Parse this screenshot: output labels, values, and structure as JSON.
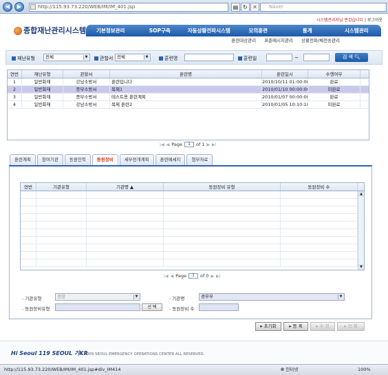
{
  "browser": {
    "address": "http://115.93.73.220/WEB/IM/IM_401.jsp",
    "search_placeholder": "Naver"
  },
  "header": {
    "welcome": "시스템관리자님 반갑습니다",
    "logout": "로그아웃",
    "logo_text": "종합재난관리시스템",
    "menu": [
      "기본정보관리",
      "SOP구축",
      "자동상황전파시스템",
      "모의훈련",
      "통계",
      "시스템관리"
    ],
    "submenu": [
      "훈련대상관리",
      "표준메시지관리",
      "상황전파/체전송관리"
    ]
  },
  "search": {
    "disaster_type_label": "재난유형",
    "disaster_type_value": "전체",
    "office_label": "관할서",
    "office_value": "전체",
    "training_name_label": "훈련명",
    "training_date_label": "훈련일",
    "date_sep": "~",
    "search_button": "검 색"
  },
  "grid1": {
    "columns": [
      "연번",
      "재난유형",
      "관할서",
      "훈련명",
      "훈련일시",
      "수행여부"
    ],
    "rows": [
      [
        "1",
        "일반화재",
        "강남소방서",
        "훈련입니다",
        "2010/10/11 01:00:00",
        "완료"
      ],
      [
        "2",
        "일반화재",
        "종부소방서",
        "복제1",
        "2010/01/10 00:00:00",
        "미완료"
      ],
      [
        "3",
        "일반화재",
        "종부소방서",
        "테스트용 훈련계획",
        "2010/01/07 00:00:00",
        "완료"
      ],
      [
        "4",
        "일반화재",
        "강남소방서",
        "복제 훈련2",
        "2010/01/05 10:10:10",
        "미완료"
      ]
    ],
    "selected_row": 1,
    "page_label": "Page",
    "page_value": "1",
    "page_of": "of 1"
  },
  "tabs": [
    "훈련계획",
    "참여기관",
    "동원인력",
    "동원장비",
    "세부전개계획",
    "훈련메세지",
    "첨부자료"
  ],
  "active_tab": 3,
  "grid2": {
    "columns": [
      "연번",
      "기관유형",
      "기관명 ▲",
      "동원장비 유형",
      "동원장비 수"
    ],
    "page_label": "Page",
    "page_value": "1",
    "page_of": "of 0"
  },
  "form": {
    "org_type_label": "기관유형",
    "org_type_value": "경찰",
    "org_name_label": "기관명",
    "org_name_value": "경무부",
    "equip_type_label": "동원장비유형",
    "select_button": "선 택",
    "equip_count_label": "동원장비 수"
  },
  "actions": [
    "초기화",
    "등 록",
    "수 정",
    "삭 제"
  ],
  "footer": {
    "logo": "Hi Seoul 119 SEOUL 기KR",
    "copyright": "© 2009 SEOUL EMERGENCY OPERATIONS CENTER ALL RESERVED."
  },
  "statusbar": {
    "url": "http://115.93.73.220/WEB/IM/IM_401.jsp#div_IM414",
    "zone": "인터넷",
    "zoom": "100%"
  },
  "colors": {
    "menu_blue": "#1c5aa8",
    "active_tab_red": "#d13b21",
    "selected_row": "#c9c9ec"
  }
}
